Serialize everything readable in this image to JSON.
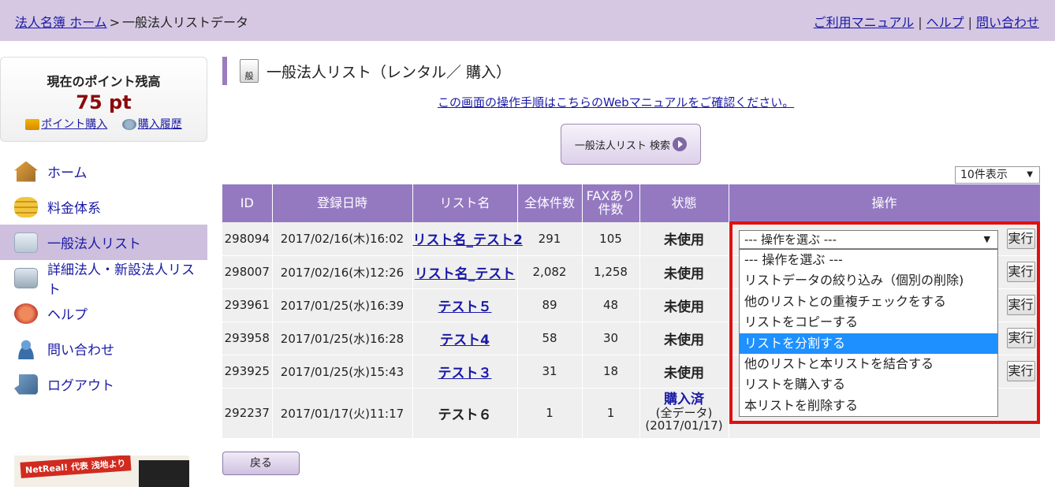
{
  "header": {
    "breadcrumb_home": "法人名簿 ホーム",
    "breadcrumb_sep": ">",
    "breadcrumb_current": "一般法人リストデータ",
    "links": [
      "ご利用マニュアル",
      "ヘルプ",
      "問い合わせ"
    ],
    "link_sep": "|"
  },
  "sidebar": {
    "points_title": "現在のポイント残高",
    "points_value": "75 pt",
    "buy_points": "ポイント購入",
    "purchase_history": "購入履歴",
    "nav": [
      {
        "label": "ホーム",
        "icon": "house-icon"
      },
      {
        "label": "料金体系",
        "icon": "coins-icon"
      },
      {
        "label": "一般法人リスト",
        "icon": "list-icon",
        "active": true
      },
      {
        "label": "詳細法人・新設法人リスト",
        "icon": "list-detail-icon"
      },
      {
        "label": "ヘルプ",
        "icon": "help-icon"
      },
      {
        "label": "問い合わせ",
        "icon": "support-person-icon"
      },
      {
        "label": "ログアウト",
        "icon": "logout-icon"
      }
    ],
    "promo_tag": "NetReal! 代表 浅地より"
  },
  "main": {
    "title_icon_text": "般",
    "title": "一般法人リスト（レンタル／ 購入）",
    "manual_link": "この画面の操作手順はこちらのWebマニュアルをご確認ください。",
    "search_button": "一般法人リスト 検索",
    "per_page": "10件表示",
    "back_button": "戻る"
  },
  "table": {
    "headers": {
      "id": "ID",
      "date": "登録日時",
      "name": "リスト名",
      "total": "全体件数",
      "fax": "FAXあり件数",
      "status": "状態",
      "ops": "操作"
    },
    "exec_label": "実行",
    "rows": [
      {
        "id": "298094",
        "date": "2017/02/16(木)16:02",
        "name": "リスト名_テスト2",
        "total": "291",
        "fax": "105",
        "status": "未使用"
      },
      {
        "id": "298007",
        "date": "2017/02/16(木)12:26",
        "name": "リスト名_テスト",
        "total": "2,082",
        "fax": "1,258",
        "status": "未使用"
      },
      {
        "id": "293961",
        "date": "2017/01/25(水)16:39",
        "name": "テスト５",
        "total": "89",
        "fax": "48",
        "status": "未使用"
      },
      {
        "id": "293958",
        "date": "2017/01/25(水)16:28",
        "name": "テスト4",
        "total": "58",
        "fax": "30",
        "status": "未使用"
      },
      {
        "id": "293925",
        "date": "2017/01/25(水)15:43",
        "name": "テスト３",
        "total": "31",
        "fax": "18",
        "status": "未使用"
      },
      {
        "id": "292237",
        "date": "2017/01/17(火)11:17",
        "name": "テスト６",
        "total": "1",
        "fax": "1",
        "status": "購入済",
        "status_sub1": "(全データ)",
        "status_sub2": "(2017/01/17)"
      }
    ]
  },
  "dropdown": {
    "selected": "--- 操作を選ぶ ---",
    "highlighted_index": 4,
    "options": [
      "--- 操作を選ぶ ---",
      "リストデータの絞り込み（個別の削除)",
      "他のリストとの重複チェックをする",
      "リストをコピーする",
      "リストを分割する",
      "他のリストと本リストを結合する",
      "リストを購入する",
      "本リストを削除する"
    ]
  },
  "colors": {
    "header_bg": "#d6c8e2",
    "table_header": "#9479c1",
    "highlight": "#e01010",
    "selected_option": "#1e90ff"
  }
}
